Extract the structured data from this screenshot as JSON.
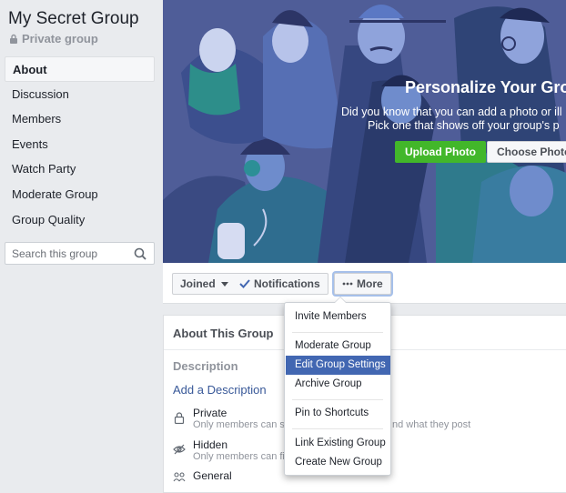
{
  "group": {
    "name": "My Secret Group",
    "privacy": "Private group"
  },
  "sidebar": {
    "items": [
      {
        "label": "About",
        "active": true
      },
      {
        "label": "Discussion"
      },
      {
        "label": "Members"
      },
      {
        "label": "Events"
      },
      {
        "label": "Watch Party"
      },
      {
        "label": "Moderate Group"
      },
      {
        "label": "Group Quality"
      }
    ],
    "search_placeholder": "Search this group"
  },
  "cover": {
    "heading": "Personalize Your Grou",
    "text1": "Did you know that you can add a photo or ill",
    "text2": "Pick one that shows off your group's p",
    "upload_label": "Upload Photo",
    "choose_label": "Choose Photo"
  },
  "actions": {
    "joined": "Joined",
    "notifications": "Notifications",
    "more": "More"
  },
  "about": {
    "title": "About This Group",
    "description_label": "Description",
    "add_description": "Add a Description",
    "private_title": "Private",
    "private_sub": "Only members can s",
    "private_tail": "nd what they post",
    "hidden_title": "Hidden",
    "hidden_sub": "Only members can fi",
    "general_title": "General"
  },
  "menu": {
    "items": [
      "Invite Members",
      "Moderate Group",
      "Edit Group Settings",
      "Archive Group",
      "Pin to Shortcuts",
      "Link Existing Group",
      "Create New Group"
    ],
    "highlighted": "Edit Group Settings"
  },
  "colors": {
    "accent": "#4267b2",
    "green": "#42b72a",
    "link": "#385898",
    "cover": "#4d5c95"
  }
}
